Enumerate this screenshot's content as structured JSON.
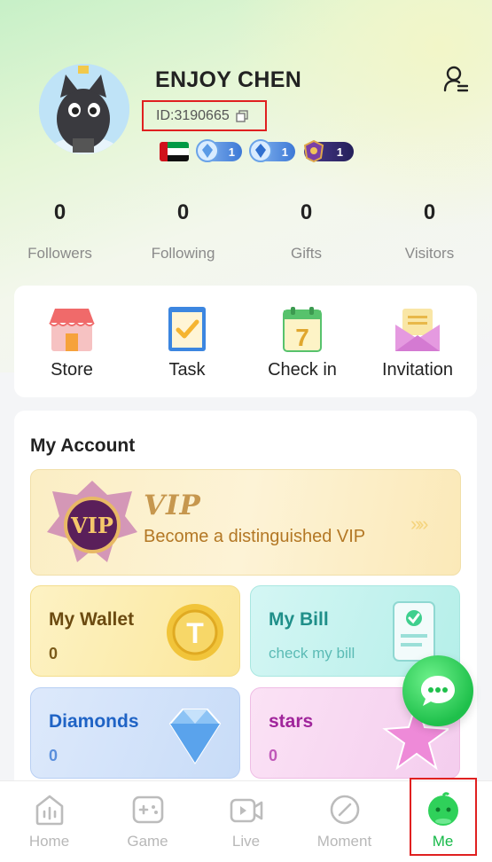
{
  "profile": {
    "name": "ENJOY CHEN",
    "id_text": "ID:3190665",
    "badges": [
      {
        "icon": "uae-flag-icon"
      },
      {
        "icon": "blue-gem-badge-icon",
        "level": "1"
      },
      {
        "icon": "blue-gem-badge-icon",
        "level": "1"
      },
      {
        "icon": "purple-crest-badge-icon",
        "level": "1"
      }
    ]
  },
  "stats": [
    {
      "value": "0",
      "label": "Followers"
    },
    {
      "value": "0",
      "label": "Following"
    },
    {
      "value": "0",
      "label": "Gifts"
    },
    {
      "value": "0",
      "label": "Visitors"
    }
  ],
  "quick_actions": [
    {
      "label": "Store",
      "icon": "store-icon"
    },
    {
      "label": "Task",
      "icon": "task-icon"
    },
    {
      "label": "Check in",
      "icon": "calendar-icon"
    },
    {
      "label": "Invitation",
      "icon": "envelope-icon"
    }
  ],
  "account": {
    "title": "My Account",
    "vip": {
      "badge_text": "VIP",
      "word": "VIP",
      "subtitle": "Become a distinguished VIP",
      "arrows": "»»"
    },
    "wallet": {
      "title": "My Wallet",
      "value": "0"
    },
    "bill": {
      "title": "My Bill",
      "subtitle": "check my bill"
    },
    "diamonds": {
      "title": "Diamonds",
      "value": "0"
    },
    "stars": {
      "title": "stars",
      "value": "0"
    }
  },
  "tabs": [
    {
      "label": "Home"
    },
    {
      "label": "Game"
    },
    {
      "label": "Live"
    },
    {
      "label": "Moment"
    },
    {
      "label": "Me"
    }
  ],
  "colors": {
    "accent": "#16b948",
    "highlight": "#e02020"
  }
}
